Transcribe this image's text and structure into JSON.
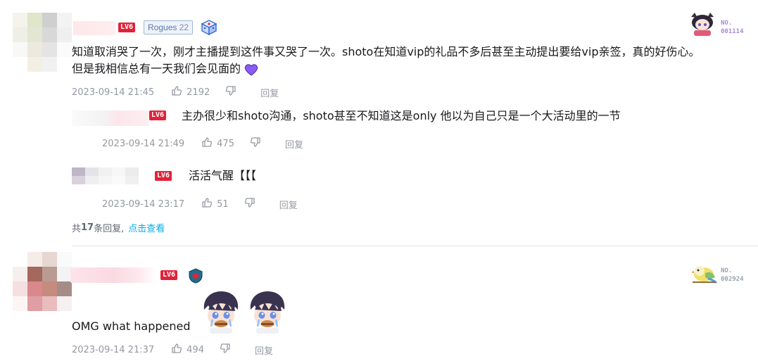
{
  "comments": [
    {
      "level": "LV6",
      "fan_badge": {
        "name": "Rogues",
        "level": "22"
      },
      "text_line1": "知道取消哭了一次，刚才主播提到这件事又哭了一次。shoto在知道vip的礼品不多后甚至主动提出要给vip亲签，真的好伤心。",
      "text_line2": "但是我相信总有一天我们会见面的",
      "emoji": "purple-heart",
      "time": "2023-09-14 21:45",
      "likes": "2192",
      "reply_label": "回复",
      "nft_label": "NO.",
      "nft_number": "001114",
      "replies": [
        {
          "level": "LV6",
          "text": "主办很少和shoto沟通，shoto甚至不知道这是only 他以为自己只是一个大活动里的一节",
          "time": "2023-09-14 21:49",
          "likes": "475",
          "reply_label": "回复"
        },
        {
          "level": "LV6",
          "text": "活活气醒【【【",
          "time": "2023-09-14 23:17",
          "likes": "51",
          "reply_label": "回复"
        }
      ],
      "reply_summary": {
        "prefix": "共",
        "count": "17",
        "suffix": "条回复,",
        "view_link": "点击查看"
      }
    },
    {
      "level": "LV6",
      "text": "OMG what happened",
      "stickers": [
        "chibi-boy-crying-sticker",
        "chibi-boy-crying-sticker"
      ],
      "time": "2023-09-14 21:37",
      "likes": "494",
      "reply_label": "回复",
      "nft_label": "NO.",
      "nft_number": "002924"
    }
  ],
  "colors": {
    "level_badge": "#e0233a",
    "link": "#00aeec",
    "meta": "#9499a0",
    "heart": "#8a5cf5",
    "divider": "#e3e5e7"
  }
}
